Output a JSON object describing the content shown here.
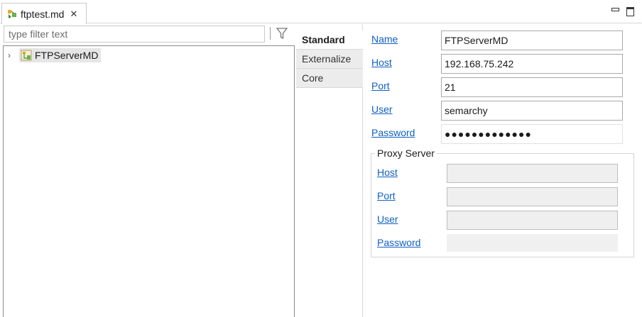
{
  "editor_tab": {
    "title": "ftptest.md",
    "close": "✕"
  },
  "filter": {
    "placeholder": "type filter text"
  },
  "tree": {
    "expander": "›",
    "items": [
      {
        "label": "FTPServerMD"
      }
    ]
  },
  "vtabs": [
    {
      "label": "Standard",
      "active": true
    },
    {
      "label": "Externalize",
      "active": false
    },
    {
      "label": "Core",
      "active": false
    }
  ],
  "form": {
    "name_label": "Name",
    "name_value": "FTPServerMD",
    "host_label": "Host",
    "host_value": "192.168.75.242",
    "port_label": "Port",
    "port_value": "21",
    "user_label": "User",
    "user_value": "semarchy",
    "password_label": "Password",
    "password_value": "●●●●●●●●●●●●●"
  },
  "proxy": {
    "title": "Proxy Server",
    "host_label": "Host",
    "port_label": "Port",
    "user_label": "User",
    "password_label": "Password"
  },
  "colors": {
    "link": "#1060c0",
    "selection": "#e6e6e6",
    "disabled_field": "#efefef"
  },
  "icons": [
    "file-icon",
    "close-icon",
    "minimize-icon",
    "maximize-icon",
    "filter-icon",
    "chevron-right-icon",
    "server-node-icon"
  ]
}
